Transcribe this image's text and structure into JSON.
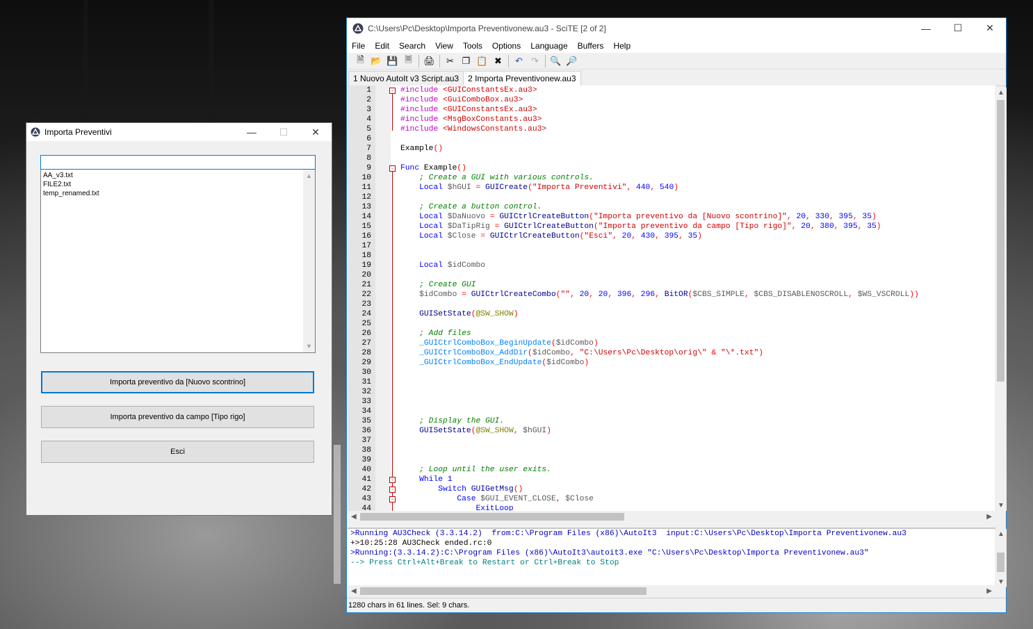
{
  "gui": {
    "title": "Importa Preventivi",
    "combo_text": "",
    "list_items": [
      "AA_v3.txt",
      "FILE2.txt",
      "temp_renamed.txt"
    ],
    "buttons": [
      "Importa preventivo da [Nuovo scontrino]",
      "Importa preventivo da campo [Tipo rigo]",
      "Esci"
    ]
  },
  "scite": {
    "title": "C:\\Users\\Pc\\Desktop\\Importa Preventivonew.au3 - SciTE [2 of 2]",
    "menu": [
      "File",
      "Edit",
      "Search",
      "View",
      "Tools",
      "Options",
      "Language",
      "Buffers",
      "Help"
    ],
    "tabs": [
      "1 Nuovo AutoIt v3 Script.au3",
      "2 Importa Preventivonew.au3"
    ],
    "lines": [
      [
        [
          "#include ",
          "c-dir"
        ],
        [
          "<GUIConstantsEx.au3>",
          "c-str"
        ]
      ],
      [
        [
          "#include ",
          "c-dir"
        ],
        [
          "<GuiComboBox.au3>",
          "c-str"
        ]
      ],
      [
        [
          "#include ",
          "c-dir"
        ],
        [
          "<GUIConstantsEx.au3>",
          "c-str"
        ]
      ],
      [
        [
          "#include ",
          "c-dir"
        ],
        [
          "<MsgBoxConstants.au3>",
          "c-str"
        ]
      ],
      [
        [
          "#include ",
          "c-dir"
        ],
        [
          "<WindowsConstants.au3>",
          "c-str"
        ]
      ],
      [],
      [
        [
          "Example",
          "c-def"
        ],
        [
          "()",
          "c-op"
        ]
      ],
      [],
      [
        [
          "Func ",
          "c-kw"
        ],
        [
          "Example",
          "c-def"
        ],
        [
          "()",
          "c-op"
        ]
      ],
      [
        [
          "    ; Create a GUI with various controls.",
          "c-cmt"
        ]
      ],
      [
        [
          "    Local ",
          "c-kw"
        ],
        [
          "$hGUI ",
          "c-var"
        ],
        [
          "= ",
          "c-op"
        ],
        [
          "GUICreate",
          "c-fn"
        ],
        [
          "(",
          "c-op"
        ],
        [
          "\"Importa Preventivi\"",
          "c-str"
        ],
        [
          ", ",
          "c-op"
        ],
        [
          "440",
          "c-num"
        ],
        [
          ", ",
          "c-op"
        ],
        [
          "540",
          "c-num"
        ],
        [
          ")",
          "c-op"
        ]
      ],
      [],
      [
        [
          "    ; Create a button control.",
          "c-cmt"
        ]
      ],
      [
        [
          "    Local ",
          "c-kw"
        ],
        [
          "$DaNuovo ",
          "c-var"
        ],
        [
          "= ",
          "c-op"
        ],
        [
          "GUICtrlCreateButton",
          "c-fn"
        ],
        [
          "(",
          "c-op"
        ],
        [
          "\"Importa preventivo da [Nuovo scontrino]\"",
          "c-str"
        ],
        [
          ", ",
          "c-op"
        ],
        [
          "20",
          "c-num"
        ],
        [
          ", ",
          "c-op"
        ],
        [
          "330",
          "c-num"
        ],
        [
          ", ",
          "c-op"
        ],
        [
          "395",
          "c-num"
        ],
        [
          ", ",
          "c-op"
        ],
        [
          "35",
          "c-num"
        ],
        [
          ")",
          "c-op"
        ]
      ],
      [
        [
          "    Local ",
          "c-kw"
        ],
        [
          "$DaTipRig ",
          "c-var"
        ],
        [
          "= ",
          "c-op"
        ],
        [
          "GUICtrlCreateButton",
          "c-fn"
        ],
        [
          "(",
          "c-op"
        ],
        [
          "\"Importa preventivo da campo [Tipo rigo]\"",
          "c-str"
        ],
        [
          ", ",
          "c-op"
        ],
        [
          "20",
          "c-num"
        ],
        [
          ", ",
          "c-op"
        ],
        [
          "380",
          "c-num"
        ],
        [
          ", ",
          "c-op"
        ],
        [
          "395",
          "c-num"
        ],
        [
          ", ",
          "c-op"
        ],
        [
          "35",
          "c-num"
        ],
        [
          ")",
          "c-op"
        ]
      ],
      [
        [
          "    Local ",
          "c-kw"
        ],
        [
          "$Close ",
          "c-var"
        ],
        [
          "= ",
          "c-op"
        ],
        [
          "GUICtrlCreateButton",
          "c-fn"
        ],
        [
          "(",
          "c-op"
        ],
        [
          "\"Esci\"",
          "c-str"
        ],
        [
          ", ",
          "c-op"
        ],
        [
          "20",
          "c-num"
        ],
        [
          ", ",
          "c-op"
        ],
        [
          "430",
          "c-num"
        ],
        [
          ", ",
          "c-op"
        ],
        [
          "395",
          "c-num"
        ],
        [
          ", ",
          "c-op"
        ],
        [
          "35",
          "c-num"
        ],
        [
          ")",
          "c-op"
        ]
      ],
      [],
      [],
      [
        [
          "    Local ",
          "c-kw"
        ],
        [
          "$idCombo",
          "c-var"
        ]
      ],
      [],
      [
        [
          "    ; Create GUI",
          "c-cmt"
        ]
      ],
      [
        [
          "    $idCombo ",
          "c-var"
        ],
        [
          "= ",
          "c-op"
        ],
        [
          "GUICtrlCreateCombo",
          "c-fn"
        ],
        [
          "(",
          "c-op"
        ],
        [
          "\"\"",
          "c-str"
        ],
        [
          ", ",
          "c-op"
        ],
        [
          "20",
          "c-num"
        ],
        [
          ", ",
          "c-op"
        ],
        [
          "20",
          "c-num"
        ],
        [
          ", ",
          "c-op"
        ],
        [
          "396",
          "c-num"
        ],
        [
          ", ",
          "c-op"
        ],
        [
          "296",
          "c-num"
        ],
        [
          ", ",
          "c-op"
        ],
        [
          "BitOR",
          "c-fn"
        ],
        [
          "(",
          "c-op"
        ],
        [
          "$CBS_SIMPLE",
          "c-var"
        ],
        [
          ", ",
          "c-op"
        ],
        [
          "$CBS_DISABLENOSCROLL",
          "c-var"
        ],
        [
          ", ",
          "c-op"
        ],
        [
          "$WS_VSCROLL",
          "c-var"
        ],
        [
          "))",
          "c-op"
        ]
      ],
      [],
      [
        [
          "    GUISetState",
          "c-fn"
        ],
        [
          "(",
          "c-op"
        ],
        [
          "@SW_SHOW",
          "c-mac"
        ],
        [
          ")",
          "c-op"
        ]
      ],
      [],
      [
        [
          "    ; Add files",
          "c-cmt"
        ]
      ],
      [
        [
          "    _GUICtrlComboBox_BeginUpdate",
          "c-udf"
        ],
        [
          "(",
          "c-op"
        ],
        [
          "$idCombo",
          "c-var"
        ],
        [
          ")",
          "c-op"
        ]
      ],
      [
        [
          "    _GUICtrlComboBox_AddDir",
          "c-udf"
        ],
        [
          "(",
          "c-op"
        ],
        [
          "$idCombo",
          "c-var"
        ],
        [
          ", ",
          "c-op"
        ],
        [
          "\"C:\\Users\\Pc\\Desktop\\orig\\\" ",
          "c-str"
        ],
        [
          "& ",
          "c-op"
        ],
        [
          "\"\\*.txt\"",
          "c-str"
        ],
        [
          ")",
          "c-op"
        ]
      ],
      [
        [
          "    _GUICtrlComboBox_EndUpdate",
          "c-udf"
        ],
        [
          "(",
          "c-op"
        ],
        [
          "$idCombo",
          "c-var"
        ],
        [
          ")",
          "c-op"
        ]
      ],
      [],
      [],
      [],
      [],
      [],
      [
        [
          "    ; Display the GUI.",
          "c-cmt"
        ]
      ],
      [
        [
          "    GUISetState",
          "c-fn"
        ],
        [
          "(",
          "c-op"
        ],
        [
          "@SW_SHOW",
          "c-mac"
        ],
        [
          ", ",
          "c-op"
        ],
        [
          "$hGUI",
          "c-var"
        ],
        [
          ")",
          "c-op"
        ]
      ],
      [],
      [],
      [],
      [
        [
          "    ; Loop until the user exits.",
          "c-cmt"
        ]
      ],
      [
        [
          "    While ",
          "c-kw"
        ],
        [
          "1",
          "c-num"
        ]
      ],
      [
        [
          "        Switch ",
          "c-kw"
        ],
        [
          "GUIGetMsg",
          "c-fn"
        ],
        [
          "()",
          "c-op"
        ]
      ],
      [
        [
          "            Case ",
          "c-kw"
        ],
        [
          "$GUI_EVENT_CLOSE",
          "c-var"
        ],
        [
          ", ",
          "c-op"
        ],
        [
          "$Close",
          "c-var"
        ]
      ],
      [
        [
          "                ExitLoop",
          "c-kw"
        ]
      ]
    ],
    "output": [
      [
        ">Running AU3Check (3.3.14.2)  from:C:\\Program Files (x86)\\AutoIt3  input:C:\\Users\\Pc\\Desktop\\Importa Preventivonew.au3",
        "#0000c0"
      ],
      [
        "+>10:25:28 AU3Check ended.rc:0",
        "#000000"
      ],
      [
        ">Running:(3.3.14.2):C:\\Program Files (x86)\\AutoIt3\\autoit3.exe \"C:\\Users\\Pc\\Desktop\\Importa Preventivonew.au3\"",
        "#0000c0"
      ],
      [
        "--> Press Ctrl+Alt+Break to Restart or Ctrl+Break to Stop",
        "#008080"
      ]
    ],
    "status": "1280 chars in 61 lines. Sel: 9 chars."
  }
}
